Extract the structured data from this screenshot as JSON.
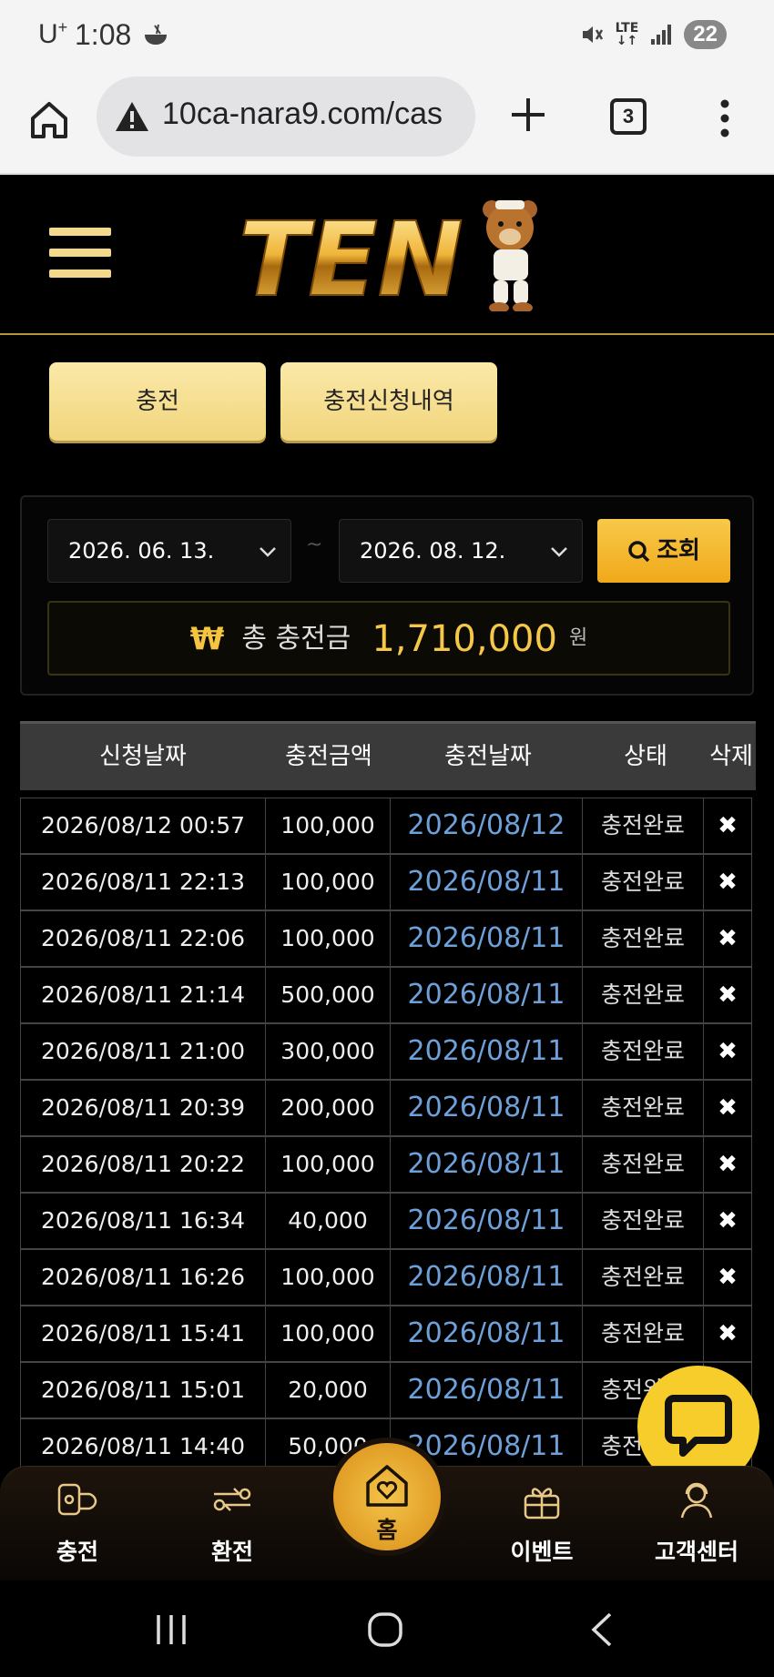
{
  "status_bar": {
    "carrier": "U",
    "carrier_sup": "+",
    "time": "1:08",
    "network": "LTE",
    "battery": "22"
  },
  "browser": {
    "url": "10ca-nara9.com/cas",
    "tab_count": "3"
  },
  "header": {
    "logo_text": "TEN"
  },
  "tabs": {
    "charge": "충전",
    "history": "충전신청내역"
  },
  "filter": {
    "date_from": "2026. 06. 13.",
    "date_to": "2026. 08. 12.",
    "separator": "~",
    "search_label": "조회",
    "won_symbol": "₩",
    "total_label": "총 충전금",
    "total_value": "1,710,000",
    "total_unit": "원"
  },
  "table": {
    "headers": [
      "신청날짜",
      "충전금액",
      "충전날짜",
      "상태",
      "삭제"
    ],
    "rows": [
      {
        "requested": "2026/08/12 00:57",
        "amount": "100,000",
        "charged": "2026/08/12",
        "status": "충전완료",
        "delete": "✖"
      },
      {
        "requested": "2026/08/11 22:13",
        "amount": "100,000",
        "charged": "2026/08/11",
        "status": "충전완료",
        "delete": "✖"
      },
      {
        "requested": "2026/08/11 22:06",
        "amount": "100,000",
        "charged": "2026/08/11",
        "status": "충전완료",
        "delete": "✖"
      },
      {
        "requested": "2026/08/11 21:14",
        "amount": "500,000",
        "charged": "2026/08/11",
        "status": "충전완료",
        "delete": "✖"
      },
      {
        "requested": "2026/08/11 21:00",
        "amount": "300,000",
        "charged": "2026/08/11",
        "status": "충전완료",
        "delete": "✖"
      },
      {
        "requested": "2026/08/11 20:39",
        "amount": "200,000",
        "charged": "2026/08/11",
        "status": "충전완료",
        "delete": "✖"
      },
      {
        "requested": "2026/08/11 20:22",
        "amount": "100,000",
        "charged": "2026/08/11",
        "status": "충전완료",
        "delete": "✖"
      },
      {
        "requested": "2026/08/11 16:34",
        "amount": "40,000",
        "charged": "2026/08/11",
        "status": "충전완료",
        "delete": "✖"
      },
      {
        "requested": "2026/08/11 16:26",
        "amount": "100,000",
        "charged": "2026/08/11",
        "status": "충전완료",
        "delete": "✖"
      },
      {
        "requested": "2026/08/11 15:41",
        "amount": "100,000",
        "charged": "2026/08/11",
        "status": "충전완료",
        "delete": "✖"
      },
      {
        "requested": "2026/08/11 15:01",
        "amount": "20,000",
        "charged": "2026/08/11",
        "status": "충전완료",
        "delete": "✖"
      },
      {
        "requested": "2026/08/11 14:40",
        "amount": "50,000",
        "charged": "2026/08/11",
        "status": "충전완료",
        "delete": "✖"
      }
    ]
  },
  "bottom_nav": {
    "charge": "충전",
    "exchange": "환전",
    "home": "홈",
    "event": "이벤트",
    "support": "고객센터"
  },
  "colors": {
    "accent_gold": "#f6c84a",
    "link_blue": "#6ea1d9",
    "chat_yellow": "#f6cd2a"
  }
}
